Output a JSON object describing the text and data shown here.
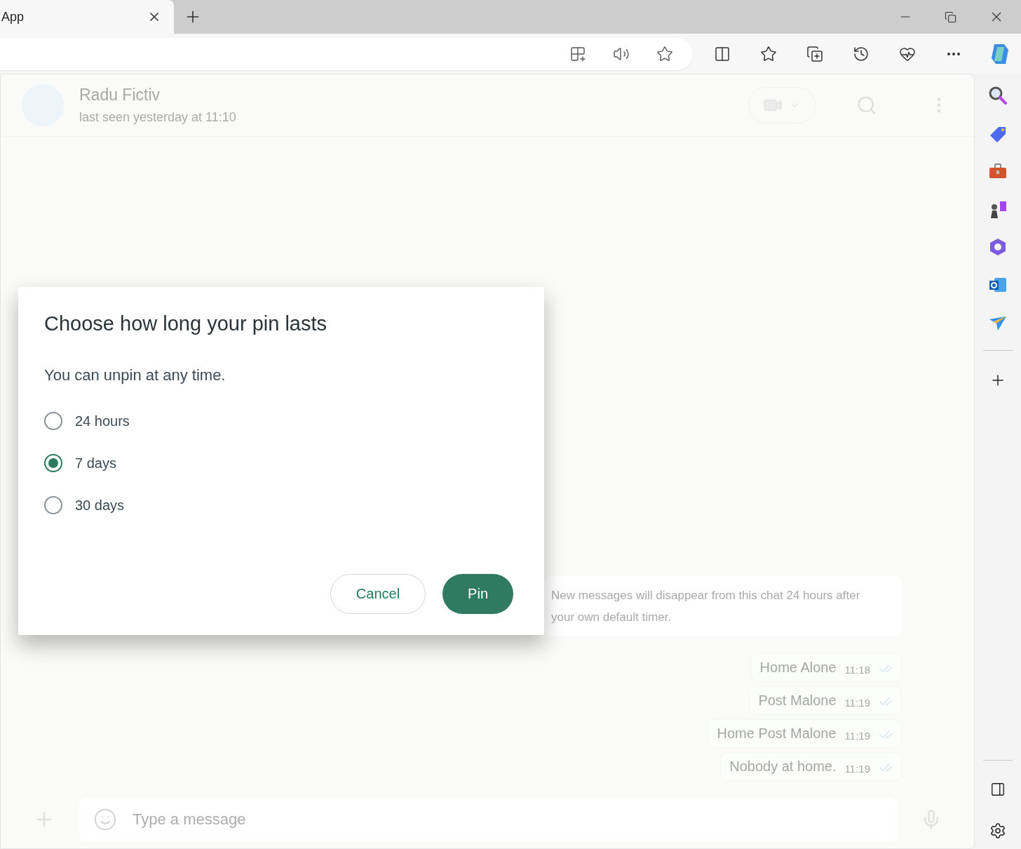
{
  "browser": {
    "tab": {
      "title": "App"
    }
  },
  "chat": {
    "contact": {
      "name": "Radu Fictiv",
      "status": "last seen yesterday at 11:10"
    },
    "notice": "New messages will disappear from this chat 24 hours after your own default timer.",
    "messages": [
      {
        "text": "Home Alone",
        "time": "11:18",
        "read": true
      },
      {
        "text": "Post Malone",
        "time": "11:19",
        "read": true
      },
      {
        "text": "Home Post Malone",
        "time": "11:19",
        "read": true
      },
      {
        "text": "Nobody at home.",
        "time": "11:19",
        "read": true
      }
    ],
    "composer": {
      "placeholder": "Type a message"
    }
  },
  "dialog": {
    "title": "Choose how long your pin lasts",
    "subtitle": "You can unpin at any time.",
    "options": [
      {
        "label": "24 hours",
        "selected": false
      },
      {
        "label": "7 days",
        "selected": true
      },
      {
        "label": "30 days",
        "selected": false
      }
    ],
    "buttons": [
      {
        "label": "Cancel",
        "kind": "secondary"
      },
      {
        "label": "Pin",
        "kind": "primary"
      }
    ]
  }
}
